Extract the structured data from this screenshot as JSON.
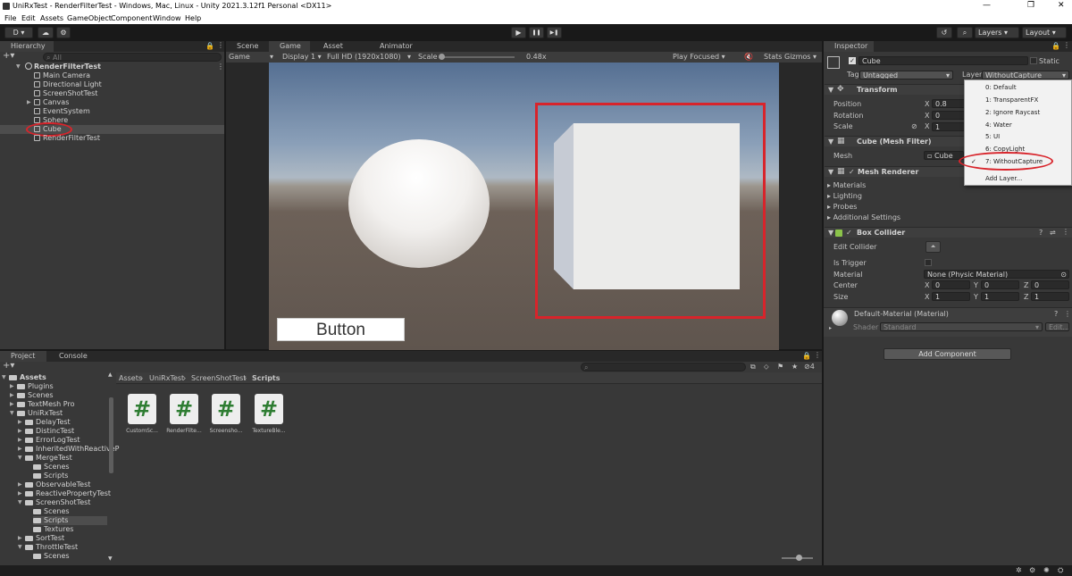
{
  "window": {
    "title": "UniRxTest - RenderFilterTest - Windows, Mac, Linux - Unity 2021.3.12f1 Personal <DX11>",
    "controls": [
      "—",
      "❐",
      "✕"
    ]
  },
  "menu": [
    "File",
    "Edit",
    "Assets",
    "GameObject",
    "Component",
    "Window",
    "Help"
  ],
  "toolbar": {
    "account": "D ▾",
    "play": "▶",
    "pause": "❚❚",
    "step": "▶❚",
    "layers": "Layers",
    "layout": "Layout"
  },
  "hierarchy": {
    "tab": "Hierarchy",
    "search_placeholder": "All",
    "scene": "RenderFilterTest",
    "items": [
      "Main Camera",
      "Directional Light",
      "ScreenShotTest",
      "Canvas",
      "EventSystem",
      "Sphere",
      "Cube",
      "RenderFilterTest"
    ]
  },
  "game": {
    "tabs": [
      "Scene",
      "Game",
      "Asset Store",
      "Animator"
    ],
    "view_mode": "Game",
    "display": "Display 1",
    "resolution": "Full HD (1920x1080)",
    "scale_label": "Scale",
    "scale_value": "0.48x",
    "play_focused": "Play Focused",
    "stats": "Stats",
    "gizmos": "Gizmos",
    "button_text": "Button"
  },
  "inspector": {
    "tab": "Inspector",
    "object_name": "Cube",
    "static_label": "Static",
    "tag_label": "Tag",
    "tag_value": "Untagged",
    "layer_label": "Layer",
    "layer_value": "WithoutCapture",
    "transform": {
      "title": "Transform",
      "position_label": "Position",
      "rotation_label": "Rotation",
      "scale_label": "Scale",
      "axis_x": "X",
      "position_x": "0.8",
      "rotation_x": "0",
      "scale_x": "1"
    },
    "mesh_filter": {
      "title": "Cube (Mesh Filter)",
      "mesh_label": "Mesh",
      "mesh_value": "Cube"
    },
    "mesh_renderer": {
      "title": "Mesh Renderer",
      "sections": [
        "Materials",
        "Lighting",
        "Probes",
        "Additional Settings"
      ]
    },
    "box_collider": {
      "title": "Box Collider",
      "edit_collider": "Edit Collider",
      "is_trigger": "Is Trigger",
      "material_label": "Material",
      "material_value": "None (Physic Material)",
      "center_label": "Center",
      "size_label": "Size",
      "x": "X",
      "y": "Y",
      "z": "Z",
      "center": [
        "0",
        "0",
        "0"
      ],
      "size": [
        "1",
        "1",
        "1"
      ]
    },
    "material": {
      "title": "Default-Material (Material)",
      "shader_label": "Shader",
      "shader_value": "Standard",
      "edit": "Edit..."
    },
    "add_component": "Add Component"
  },
  "layer_dropdown": {
    "items": [
      "0: Default",
      "1: TransparentFX",
      "2: Ignore Raycast",
      "4: Water",
      "5: UI",
      "6: CopyLight",
      "7: WithoutCapture",
      "Add Layer..."
    ],
    "checkmark": "✓"
  },
  "project": {
    "tabs": [
      "Project",
      "Console"
    ],
    "breadcrumb": [
      "Assets",
      "UniRxTest",
      "ScreenShotTest",
      "Scripts"
    ],
    "badge_count": "4",
    "tree": [
      {
        "label": "Assets",
        "depth": 0
      },
      {
        "label": "Plugins",
        "depth": 1
      },
      {
        "label": "Scenes",
        "depth": 1
      },
      {
        "label": "TextMesh Pro",
        "depth": 1
      },
      {
        "label": "UniRxTest",
        "depth": 1
      },
      {
        "label": "DelayTest",
        "depth": 2
      },
      {
        "label": "DistincTest",
        "depth": 2
      },
      {
        "label": "ErrorLogTest",
        "depth": 2
      },
      {
        "label": "InheritedWithReactiveP",
        "depth": 2
      },
      {
        "label": "MergeTest",
        "depth": 2
      },
      {
        "label": "Scenes",
        "depth": 3
      },
      {
        "label": "Scripts",
        "depth": 3
      },
      {
        "label": "ObservableTest",
        "depth": 2
      },
      {
        "label": "ReactivePropertyTest",
        "depth": 2
      },
      {
        "label": "ScreenShotTest",
        "depth": 2
      },
      {
        "label": "Scenes",
        "depth": 3
      },
      {
        "label": "Scripts",
        "depth": 3
      },
      {
        "label": "Textures",
        "depth": 3
      },
      {
        "label": "SortTest",
        "depth": 2
      },
      {
        "label": "ThrottleTest",
        "depth": 2
      },
      {
        "label": "Scenes",
        "depth": 3
      }
    ],
    "files": [
      "CustomSc...",
      "RenderFilte...",
      "Screensho...",
      "TextureBle..."
    ],
    "script_glyph": "#"
  }
}
